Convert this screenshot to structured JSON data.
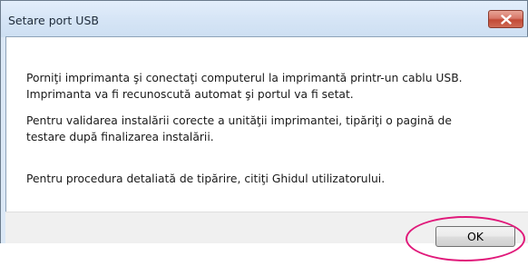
{
  "window": {
    "title": "Setare port USB",
    "close_icon": "close-icon"
  },
  "message": {
    "paragraph1_line1": "Porniţi imprimanta şi conectaţi computerul la imprimantă printr-un cablu USB.",
    "paragraph1_line2": "Imprimanta va fi recunoscută automat şi portul va fi setat.",
    "paragraph2_line1": "Pentru validarea instalării corecte a unităţii imprimantei, tipăriţi o pagină de",
    "paragraph2_line2": "testare după finalizarea instalării.",
    "paragraph3_line1": "Pentru procedura detaliată de tipărire, citiţi Ghidul utilizatorului."
  },
  "buttons": {
    "ok_label": "OK"
  },
  "colors": {
    "highlight": "#e0197a",
    "close_button": "#c24a36"
  }
}
